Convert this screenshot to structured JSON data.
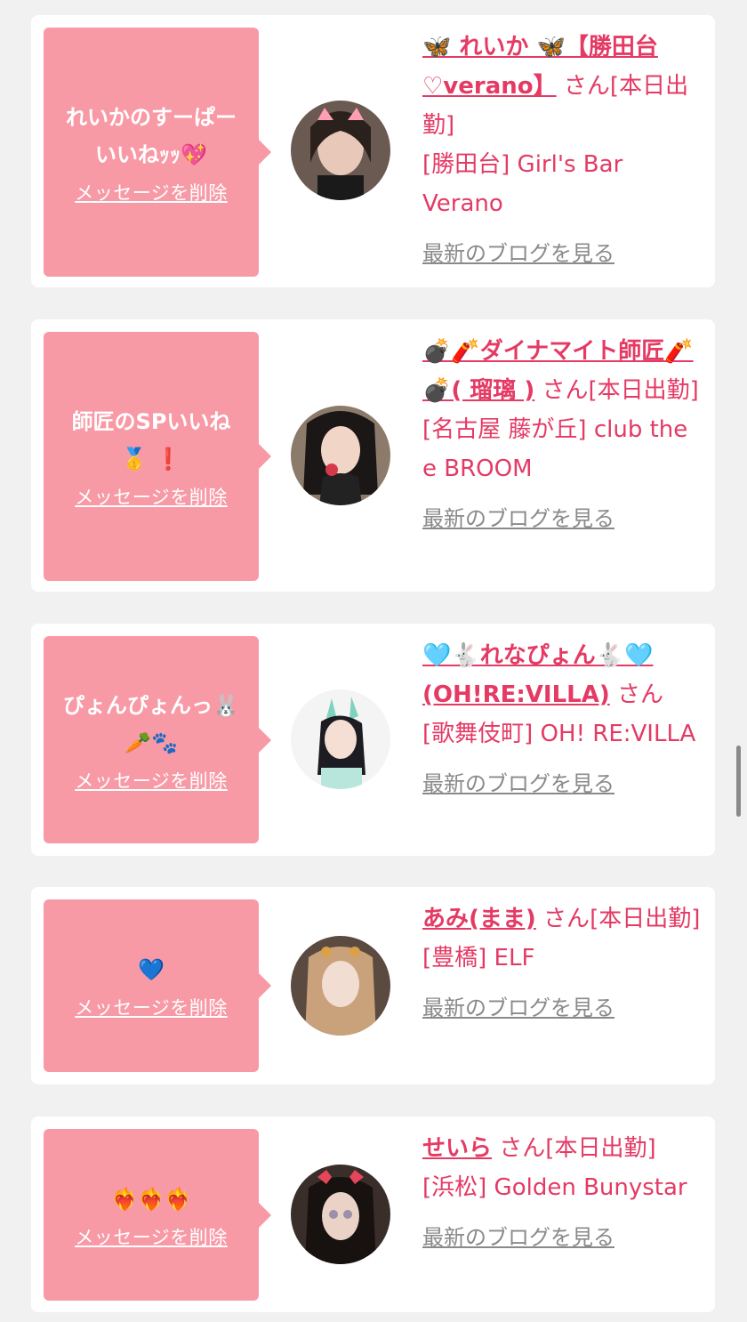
{
  "colors": {
    "background": "#f1f1f1",
    "card": "#ffffff",
    "bubble": "#f899a6",
    "accent": "#e43a64",
    "link_gray": "#8a8a8a"
  },
  "common": {
    "delete_label": "メッセージを削除",
    "blog_label": "最新のブログを見る",
    "san_suffix": "さん"
  },
  "items": [
    {
      "message_line1": "れいかのすーぱー",
      "message_line2": "いいねｯｯ💖",
      "name": "🦋 れいか 🦋【勝田台♡verano】",
      "status": "[本日出勤]",
      "shop": "[勝田台] Girl's Bar Verano"
    },
    {
      "message_line1": "師匠のSPいいね",
      "message_line2": "🥇 ❗",
      "name": "💣🧨ダイナマイト師匠🧨💣( 瑠璃 )",
      "status": "[本日出勤]",
      "shop": "[名古屋 藤が丘] club the e BROOM"
    },
    {
      "message_line1": "ぴょんぴょんっ🐰",
      "message_line2": "🥕🐾",
      "name": "🩵🐇れなぴょん🐇🩵(OH!RE:VILLA)",
      "status": "",
      "shop": "[歌舞伎町] OH! RE:VILLA"
    },
    {
      "message_line1": "💙",
      "message_line2": "",
      "name": "あみ(まま)",
      "status": "[本日出勤]",
      "shop": "[豊橋] ELF"
    },
    {
      "message_line1": "❤️‍🔥❤️‍🔥❤️‍🔥",
      "message_line2": "",
      "name": "せいら",
      "status": "[本日出勤]",
      "shop": "[浜松] Golden Bunystar"
    }
  ]
}
